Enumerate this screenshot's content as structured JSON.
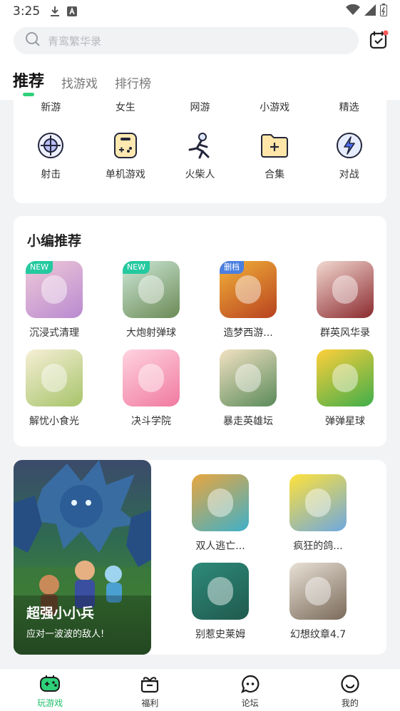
{
  "status": {
    "time": "3:25"
  },
  "search": {
    "placeholder": "青鸾繁华录"
  },
  "tabs": [
    {
      "label": "推荐",
      "active": true
    },
    {
      "label": "找游戏",
      "active": false
    },
    {
      "label": "排行榜",
      "active": false
    }
  ],
  "categories_text": [
    "新游",
    "女生",
    "网游",
    "小游戏",
    "精选"
  ],
  "categories_icon": [
    {
      "label": "射击",
      "icon": "crosshair-icon"
    },
    {
      "label": "单机游戏",
      "icon": "gamepad-icon"
    },
    {
      "label": "火柴人",
      "icon": "stickman-icon"
    },
    {
      "label": "合集",
      "icon": "folder-plus-icon"
    },
    {
      "label": "对战",
      "icon": "lightning-icon"
    }
  ],
  "recommend": {
    "title": "小编推荐",
    "games": [
      {
        "name": "沉浸式清理",
        "badge": "NEW",
        "badge_color": "#25c9a0",
        "color1": "#f0c9d8",
        "color2": "#b98ad0"
      },
      {
        "name": "大炮射弹球",
        "badge": "NEW",
        "badge_color": "#25c9a0",
        "color1": "#cde8d8",
        "color2": "#6b8a55"
      },
      {
        "name": "造梦西游...",
        "badge": "删档",
        "badge_color": "#4a7fe0",
        "color1": "#f2b23a",
        "color2": "#b8421f"
      },
      {
        "name": "群英风华录",
        "badge": "",
        "badge_color": "",
        "color1": "#f3d9d2",
        "color2": "#8b2a2e"
      },
      {
        "name": "解忧小食光",
        "badge": "",
        "badge_color": "",
        "color1": "#f6efd6",
        "color2": "#a7c46a"
      },
      {
        "name": "决斗学院",
        "badge": "",
        "badge_color": "",
        "color1": "#ffd3e0",
        "color2": "#f07aa0"
      },
      {
        "name": "暴走英雄坛",
        "badge": "",
        "badge_color": "",
        "color1": "#f2e2c2",
        "color2": "#5a8a5a"
      },
      {
        "name": "弹弹星球",
        "badge": "",
        "badge_color": "",
        "color1": "#ffcf3a",
        "color2": "#3fae4a"
      }
    ]
  },
  "featured": {
    "banner_title": "超强小小兵",
    "banner_subtitle": "应对一波波的敌人!",
    "games": [
      {
        "name": "双人逃亡...",
        "color1": "#e8a640",
        "color2": "#3fb0c8"
      },
      {
        "name": "疯狂的鸽...",
        "color1": "#ffe23a",
        "color2": "#6ea8e0"
      },
      {
        "name": "别惹史莱姆",
        "color1": "#2e8a7a",
        "color2": "#1f5a4e"
      },
      {
        "name": "幻想纹章4.7",
        "color1": "#e9e1d6",
        "color2": "#7a6a5a"
      }
    ]
  },
  "bottom_nav": [
    {
      "label": "玩游戏",
      "icon": "gamepad-icon",
      "active": true
    },
    {
      "label": "福利",
      "icon": "gift-icon",
      "active": false
    },
    {
      "label": "论坛",
      "icon": "chat-icon",
      "active": false
    },
    {
      "label": "我的",
      "icon": "smile-icon",
      "active": false
    }
  ],
  "colors": {
    "accent": "#2ed078",
    "badge_dot": "#ff5a5a"
  }
}
